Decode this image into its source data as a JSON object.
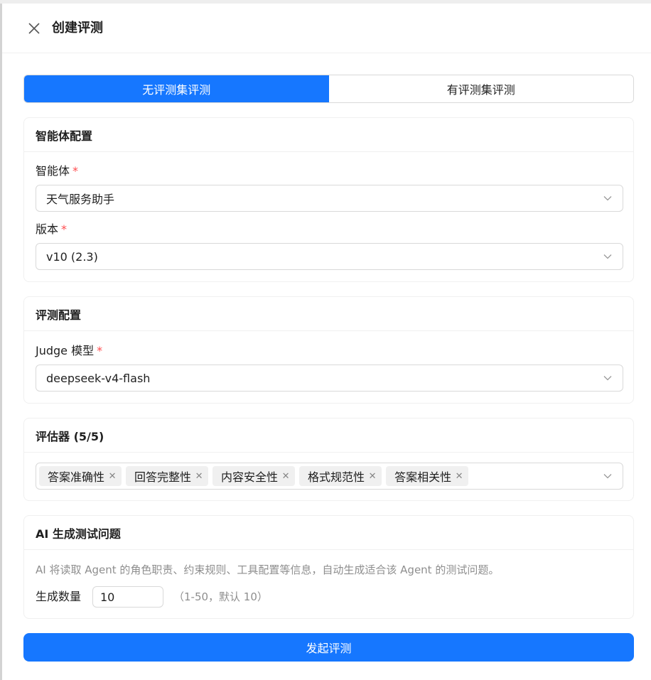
{
  "header": {
    "title": "创建评测",
    "close_icon": "close-icon"
  },
  "mode_tabs": [
    {
      "label": "无评测集评测",
      "active": true
    },
    {
      "label": "有评测集评测",
      "active": false
    }
  ],
  "agent_config": {
    "title": "智能体配置",
    "agent_label": "智能体",
    "agent_value": "天气服务助手",
    "version_label": "版本",
    "version_value": "v10 (2.3)",
    "required_mark": "*"
  },
  "eval_config": {
    "title": "评测配置",
    "judge_label": "Judge 模型",
    "judge_value": "deepseek-v4-flash",
    "required_mark": "*"
  },
  "evaluators": {
    "title": "评估器 (5/5)",
    "tags": [
      "答案准确性",
      "回答完整性",
      "内容安全性",
      "格式规范性",
      "答案相关性"
    ]
  },
  "ai_generate": {
    "title": "AI 生成测试问题",
    "description": "AI 将读取 Agent 的角色职责、约束规则、工具配置等信息，自动生成适合该 Agent 的测试问题。",
    "count_label": "生成数量",
    "count_value": "10",
    "count_hint": "（1-50，默认 10）"
  },
  "submit_label": "发起评测",
  "colors": {
    "primary": "#1677ff",
    "required": "#ff4d4f",
    "border": "#d9d9d9"
  }
}
